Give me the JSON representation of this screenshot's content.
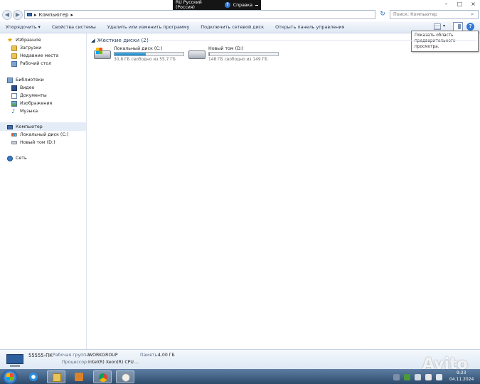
{
  "language_bar": {
    "language": "RU Русский (Россия)",
    "help": "Справка"
  },
  "caption": {
    "minimize": "–",
    "maximize": "□",
    "close": "×"
  },
  "address": {
    "back": "◀",
    "forward": "▶",
    "path": "Компьютер",
    "separator": "▸",
    "refresh": "↻"
  },
  "search": {
    "placeholder": "Поиск: Компьютер"
  },
  "toolbar": {
    "organize": "Упорядочить ▾",
    "system_properties": "Свойства системы",
    "uninstall": "Удалить или изменить программу",
    "map_drive": "Подключить сетевой диск",
    "control_panel": "Открыть панель управления",
    "views_arrow": "▾",
    "help": "?"
  },
  "tooltip": {
    "text": "Показать область предварительного просмотра."
  },
  "nav": {
    "favorites": "Избранное",
    "downloads": "Загрузки",
    "recent": "Недавние места",
    "desktop": "Рабочий стол",
    "libraries": "Библиотеки",
    "video": "Видео",
    "documents": "Документы",
    "images": "Изображения",
    "music": "Музыка",
    "computer": "Компьютер",
    "local_disk": "Локальный диск (C:)",
    "new_volume": "Новый том (D:)",
    "network": "Сеть"
  },
  "content": {
    "section_title": "Жесткие диски (2)",
    "drives": [
      {
        "name": "Локальный диск (C:)",
        "space": "30,8 ГБ свободно из 55,7 ГБ",
        "used_fraction": 0.45
      },
      {
        "name": "Новый том (D:)",
        "space": "148 ГБ свободно из 149 ГБ",
        "used_fraction": 0.01
      }
    ]
  },
  "details": {
    "computer_name": "55555-ПК",
    "workgroup_label": "Рабочая группа:",
    "workgroup": "WORKGROUP",
    "memory_label": "Память:",
    "memory": "4,00 ГБ",
    "cpu_label": "Процессор:",
    "cpu": "Intel(R) Xeon(R) CPU",
    "more": "..."
  },
  "taskbar": {
    "time": "9:23",
    "date": "04.11.2024"
  },
  "watermark": "Avito",
  "colors": {
    "drive_fill": "#1f83c5",
    "taskbar": "#2d4a6b",
    "selection": "#e4ecf7"
  }
}
